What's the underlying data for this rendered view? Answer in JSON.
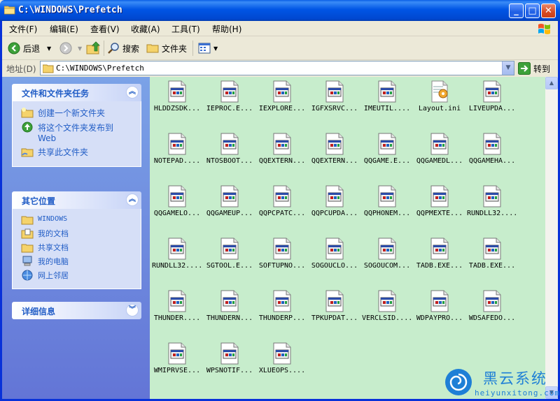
{
  "window": {
    "title": "C:\\WINDOWS\\Prefetch"
  },
  "menubar": {
    "items": [
      "文件(F)",
      "编辑(E)",
      "查看(V)",
      "收藏(A)",
      "工具(T)",
      "帮助(H)"
    ]
  },
  "toolbar": {
    "back_label": "后退",
    "search_label": "搜索",
    "folders_label": "文件夹"
  },
  "address": {
    "label": "地址(D)",
    "value": "C:\\WINDOWS\\Prefetch",
    "go_label": "转到"
  },
  "sidebar": {
    "tasks_title": "文件和文件夹任务",
    "tasks": [
      "创建一个新文件夹",
      "将这个文件夹发布到Web",
      "共享此文件夹"
    ],
    "places_title": "其它位置",
    "places": [
      "WINDOWS",
      "我的文档",
      "共享文档",
      "我的电脑",
      "网上邻居"
    ],
    "details_title": "详细信息"
  },
  "files": [
    "HLDDZSDK...",
    "IEPROC.E...",
    "IEXPLORE...",
    "IGFXSRVC...",
    "IMEUTIL....",
    "Layout.ini",
    "LIVEUPDA...",
    "NOTEPAD....",
    "NTOSBOOT...",
    "QQEXTERN...",
    "QQEXTERN...",
    "QQGAME.E...",
    "QQGAMEDL...",
    "QQGAMEHA...",
    "QQGAMELO...",
    "QQGAMEUP...",
    "QQPCPATC...",
    "QQPCUPDA...",
    "QQPHONEM...",
    "QQPMEXTE...",
    "RUNDLL32....",
    "RUNDLL32....",
    "SGTOOL.E...",
    "SOFTUPNO...",
    "SOGOUCLO...",
    "SOGOUCOM...",
    "TADB.EXE...",
    "TADB.EXE...",
    "THUNDER....",
    "THUNDERN...",
    "THUNDERP...",
    "TPKUPDAT...",
    "VERCLSID....",
    "WDPAYPRO...",
    "WDSAFEDO...",
    "WMIPRVSE...",
    "WPSNOTIF...",
    "XLUEOPS...."
  ],
  "watermark": {
    "title": "黑云系统",
    "url": "heiyunxitong.com"
  }
}
